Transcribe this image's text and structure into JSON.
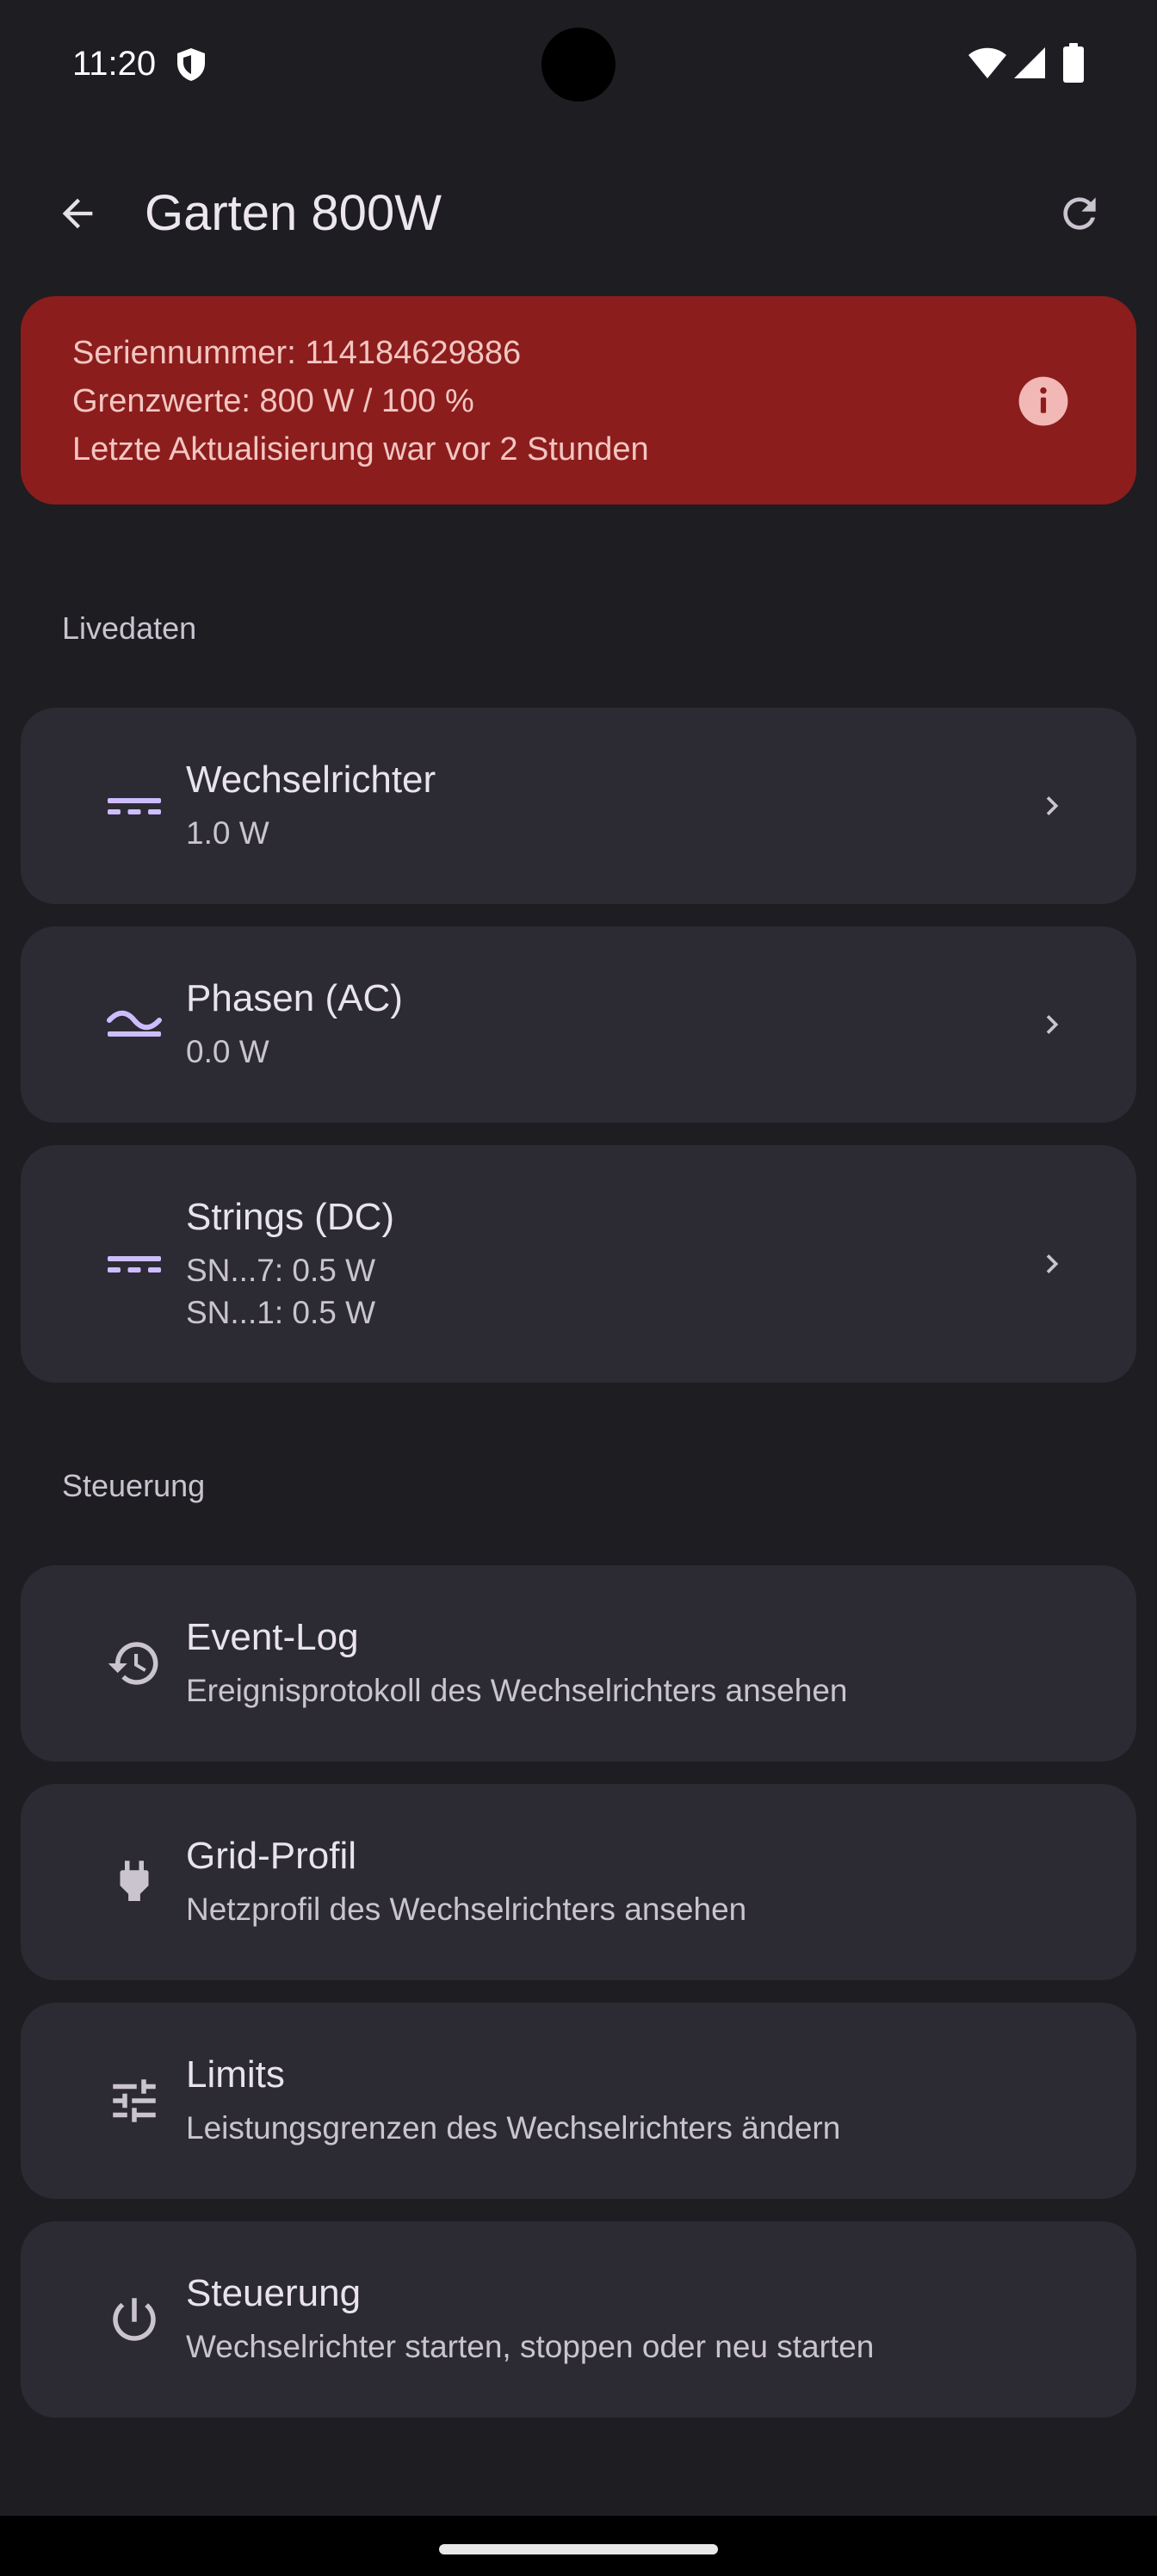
{
  "status_bar": {
    "time": "11:20",
    "shield_icon": "shield-icon",
    "wifi_icon": "wifi-icon",
    "signal_icon": "cell-signal-icon",
    "battery_icon": "battery-icon"
  },
  "app_bar": {
    "title": "Garten 800W",
    "back_icon": "arrow-back-icon",
    "refresh_icon": "refresh-icon"
  },
  "info_card": {
    "serial_line": "Seriennummer: 114184629886",
    "limits_line": "Grenzwerte: 800 W / 100 %",
    "update_line": "Letzte Aktualisierung war vor 2 Stunden",
    "info_icon": "info-icon"
  },
  "sections": {
    "live": "Livedaten",
    "control": "Steuerung"
  },
  "live_items": [
    {
      "title": "Wechselrichter",
      "sub1": "1.0 W",
      "icon": "dc-current-icon"
    },
    {
      "title": "Phasen (AC)",
      "sub1": "0.0 W",
      "icon": "ac-wave-icon"
    },
    {
      "title": "Strings (DC)",
      "sub1": "SN...7: 0.5 W",
      "sub2": "SN...1: 0.5 W",
      "icon": "dc-current-icon"
    }
  ],
  "control_items": [
    {
      "title": "Event-Log",
      "sub": "Ereignisprotokoll des Wechselrichters ansehen",
      "icon": "history-icon"
    },
    {
      "title": "Grid-Profil",
      "sub": "Netzprofil des Wechselrichters ansehen",
      "icon": "power-plug-icon"
    },
    {
      "title": "Limits",
      "sub": "Leistungsgrenzen des Wechselrichters ändern",
      "icon": "tune-sliders-icon"
    },
    {
      "title": "Steuerung",
      "sub": "Wechselrichter starten, stoppen oder neu starten",
      "icon": "power-icon"
    }
  ],
  "colors": {
    "background": "#1e1d22",
    "card": "#2c2a33",
    "error_container": "#8c1d1d",
    "on_error_container": "#f3c6c2",
    "accent": "#cdbdff",
    "info_icon_bg": "#f2b8b5"
  }
}
